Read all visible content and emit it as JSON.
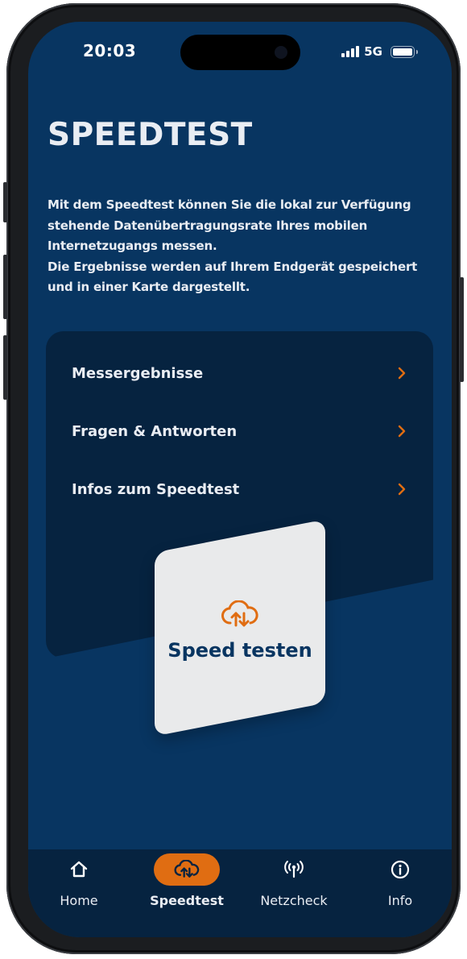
{
  "status_bar": {
    "time": "20:03",
    "network": "5G",
    "signal_bars": 4,
    "battery_level": 1.0
  },
  "page": {
    "title": "SPEEDTEST",
    "intro_line1": "Mit dem Speedtest können Sie die lokal zur Verfügung stehende Datenübertragungsrate Ihres mobilen Internetzugangs messen.",
    "intro_line2": "Die Ergebnisse werden auf Ihrem Endgerät gespeichert und in einer Karte dargestellt."
  },
  "menu": {
    "items": [
      {
        "label": "Messergebnisse",
        "icon": "chevron-right-icon"
      },
      {
        "label": "Fragen & Antworten",
        "icon": "chevron-right-icon"
      },
      {
        "label": "Infos zum Speedtest",
        "icon": "chevron-right-icon"
      }
    ]
  },
  "speed_button": {
    "label": "Speed testen",
    "icon": "cloud-upload-download-icon"
  },
  "tabbar": {
    "tabs": [
      {
        "label": "Home",
        "icon": "home-icon",
        "active": false
      },
      {
        "label": "Speedtest",
        "icon": "cloud-upload-download-icon",
        "active": true
      },
      {
        "label": "Netzcheck",
        "icon": "antenna-icon",
        "active": false
      },
      {
        "label": "Info",
        "icon": "info-icon",
        "active": false
      }
    ]
  },
  "colors": {
    "background": "#083561",
    "card": "#062340",
    "accent": "#e06d12",
    "button_face": "#e9eaeb",
    "text_light": "#e9edf3",
    "text_dark": "#083561"
  }
}
